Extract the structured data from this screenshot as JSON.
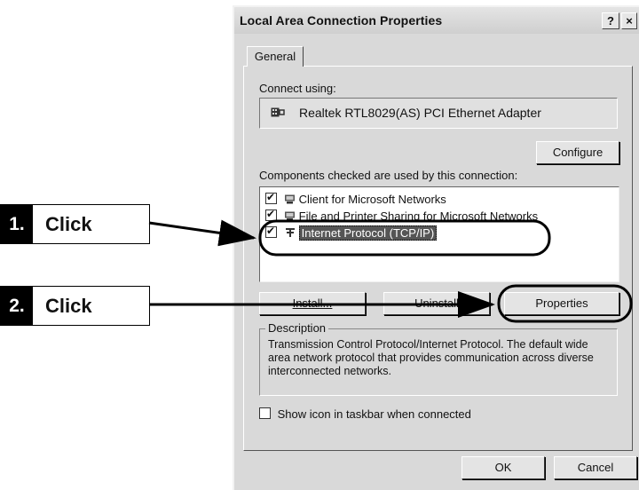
{
  "window": {
    "title": "Local Area Connection Properties",
    "help_button": "?",
    "close_button": "×"
  },
  "tabs": [
    {
      "label": "General"
    }
  ],
  "connect_using": {
    "label": "Connect using:",
    "adapter": "Realtek RTL8029(AS) PCI Ethernet Adapter",
    "configure_button": "Configure"
  },
  "components": {
    "label": "Components checked are used by this connection:",
    "items": [
      {
        "label": "Client for Microsoft Networks",
        "checked": true,
        "icon": "network-client-icon"
      },
      {
        "label": "File and Printer Sharing for Microsoft Networks",
        "checked": true,
        "icon": "file-printer-sharing-icon"
      },
      {
        "label": "Internet Protocol (TCP/IP)",
        "checked": true,
        "selected": true,
        "icon": "protocol-icon"
      }
    ]
  },
  "buttons": {
    "install": "Install...",
    "uninstall": "Uninstall",
    "properties": "Properties",
    "ok": "OK",
    "cancel": "Cancel"
  },
  "description": {
    "title": "Description",
    "text": "Transmission Control Protocol/Internet Protocol. The default wide area network protocol that provides communication across diverse interconnected networks."
  },
  "taskbar_option": {
    "label": "Show icon in taskbar when connected",
    "checked": false
  },
  "callouts": [
    {
      "number": "1.",
      "text": "Click"
    },
    {
      "number": "2.",
      "text": "Click"
    }
  ],
  "colors": {
    "dialog_face": "#d9d9d9",
    "selection": "#555555",
    "callout_fill": "#000000"
  }
}
